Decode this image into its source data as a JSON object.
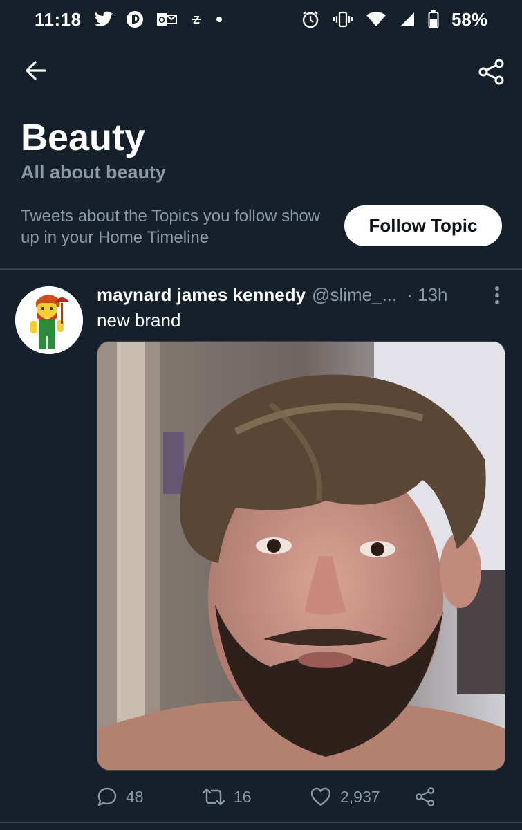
{
  "status_bar": {
    "time": "11:18",
    "battery": "58%",
    "icons": [
      "twitter-bird-icon",
      "pocket-casts-icon",
      "outlook-icon",
      "tidal-icon",
      "dot-icon",
      "alarm-icon",
      "vibrate-icon",
      "wifi-icon",
      "signal-icon",
      "battery-icon"
    ]
  },
  "nav": {
    "back_icon": "arrow-left-icon",
    "share_icon": "share-icon"
  },
  "topic": {
    "title": "Beauty",
    "subtitle": "All about beauty",
    "note": "Tweets about the Topics you follow show up in your Home Timeline",
    "follow_label": "Follow Topic"
  },
  "tweet": {
    "author_name": "maynard james kennedy",
    "author_handle": "@slime_...",
    "time": "· 13h",
    "text": "new brand",
    "avatar_icon": "lego-figure-avatar",
    "media_description_icon": "photo",
    "actions": {
      "replies": "48",
      "retweets": "16",
      "likes": "2,937"
    }
  },
  "colors": {
    "background": "#15202b",
    "secondary_text": "#8b98a5",
    "divider": "#38444d",
    "button_bg": "#ffffff"
  }
}
